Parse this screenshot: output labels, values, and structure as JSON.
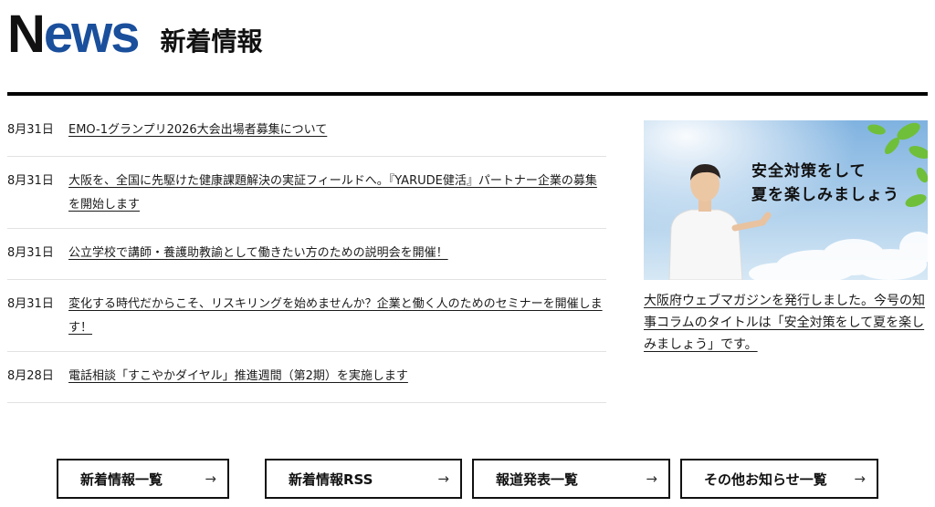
{
  "header": {
    "logo_first": "N",
    "logo_rest": "ews",
    "subtitle": "新着情報"
  },
  "news": [
    {
      "date": "8月31日",
      "title": "EMO-1グランプリ2026大会出場者募集について"
    },
    {
      "date": "8月31日",
      "title": "大阪を、全国に先駆けた健康課題解決の実証フィールドへ。『YARUDE健活』パートナー企業の募集を開始します"
    },
    {
      "date": "8月31日",
      "title": "公立学校で講師・養護助教諭として働きたい方のための説明会を開催！"
    },
    {
      "date": "8月31日",
      "title": "変化する時代だからこそ、リスキリングを始めませんか？企業と働く人のためのセミナーを開催します！"
    },
    {
      "date": "8月28日",
      "title": "電話相談「すこやかダイヤル」推進週間（第2期）を実施します"
    }
  ],
  "banner": {
    "line1": "安全対策をして",
    "line2": "夏を楽しみましょう",
    "caption": "大阪府ウェブマガジンを発行しました。今号の知事コラムのタイトルは「安全対策をして夏を楽しみましょう」です。",
    "colors": {
      "sky_top": "#6ea6d9",
      "sky_bottom": "#cfe3f3",
      "leaf": "#6fbf3a"
    }
  },
  "buttons": [
    {
      "label": "新着情報一覧",
      "arrow": "→"
    },
    {
      "label": "新着情報RSS",
      "arrow": "→"
    },
    {
      "label": "報道発表一覧",
      "arrow": "→"
    },
    {
      "label": "その他お知らせ一覧",
      "arrow": "→"
    }
  ]
}
